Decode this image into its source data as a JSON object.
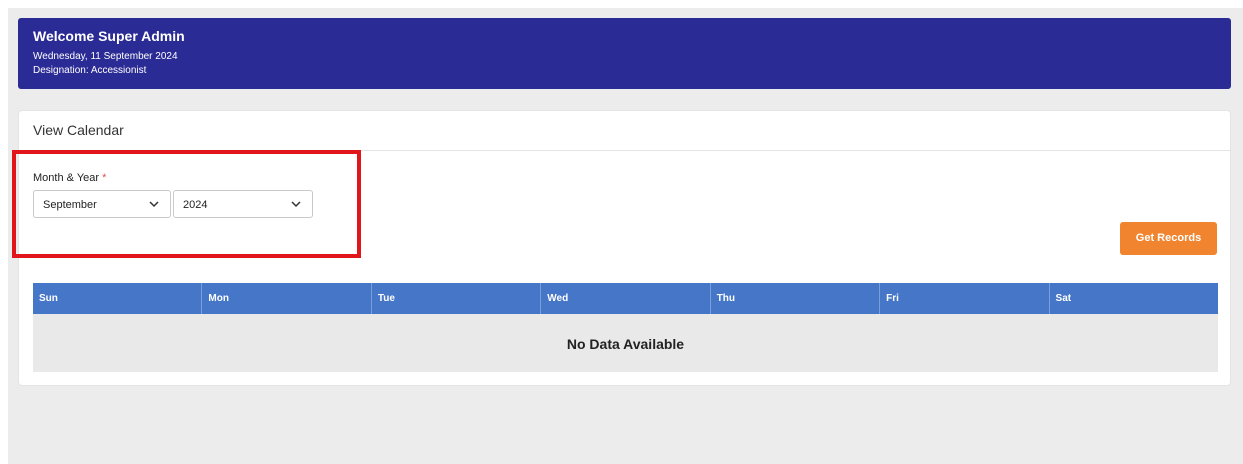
{
  "banner": {
    "title": "Welcome Super Admin",
    "date": "Wednesday, 11 September 2024",
    "designation": "Designation: Accessionist",
    "color": "#2b2b96"
  },
  "card": {
    "title": "View Calendar"
  },
  "form": {
    "label": "Month & Year",
    "required_mark": "*",
    "month_value": "September",
    "year_value": "2024"
  },
  "actions": {
    "get_records_label": "Get Records",
    "button_color": "#f0842f"
  },
  "calendar": {
    "header_color": "#4676c8",
    "days": [
      "Sun",
      "Mon",
      "Tue",
      "Wed",
      "Thu",
      "Fri",
      "Sat"
    ],
    "empty_message": "No Data Available"
  },
  "icons": {
    "select_chevron": "chevron-down-icon"
  }
}
